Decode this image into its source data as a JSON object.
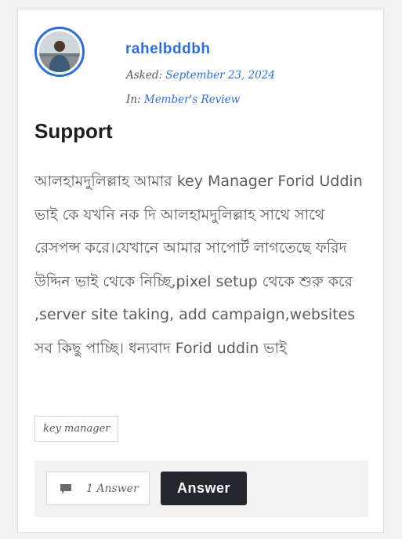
{
  "post": {
    "author": "rahelbddbh",
    "asked_label": "Asked:",
    "asked_date": "September 23, 2024",
    "in_label": "In:",
    "category": "Member's Review",
    "title": "Support",
    "body": "আলহামদুলিল্লাহ আমার key Manager Forid Uddin ভাই কে যখনি নক দি আলহামদুলিল্লাহ সাথে সাথে রেসপন্স করে।যেখানে আমার সাপোর্ট লাগতেছে ফরিদ উদ্দিন ভাই থেকে নিচ্ছি,pixel setup থেকে শুরু করে ,server site taking, add campaign,websites সব কিছু পাচ্ছি। ধন্যবাদ Forid uddin ভাই",
    "tag": "key manager"
  },
  "footer": {
    "answer_count_label": "1 Answer",
    "answer_button_label": "Answer",
    "answer_icon": "comment-icon"
  },
  "colors": {
    "accent": "#2f6fd1",
    "button_bg": "#24272e",
    "body_text": "#5d5d5d"
  }
}
